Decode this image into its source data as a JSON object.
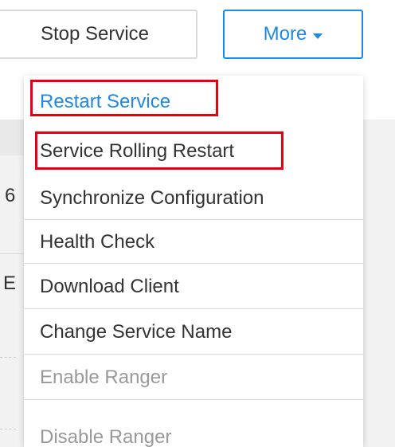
{
  "toolbar": {
    "stop_label": "Stop Service",
    "more_label": "More"
  },
  "background": {
    "row_char_1": "6",
    "row_char_2": "E"
  },
  "menu": {
    "items": [
      {
        "label": "Restart Service",
        "state": "active"
      },
      {
        "label": "Service Rolling Restart",
        "state": "normal"
      },
      {
        "label": "Synchronize Configuration",
        "state": "normal"
      },
      {
        "label": "Health Check",
        "state": "normal"
      },
      {
        "label": "Download Client",
        "state": "normal"
      },
      {
        "label": "Change Service Name",
        "state": "normal"
      },
      {
        "label": "Enable Ranger",
        "state": "disabled"
      },
      {
        "label": "Disable Ranger",
        "state": "disabled"
      }
    ]
  },
  "colors": {
    "accent": "#1e88e5",
    "highlight_box": "#e60012",
    "text": "#333333",
    "disabled_text": "#999999"
  },
  "icons": {
    "more_caret": "caret-down-icon"
  }
}
